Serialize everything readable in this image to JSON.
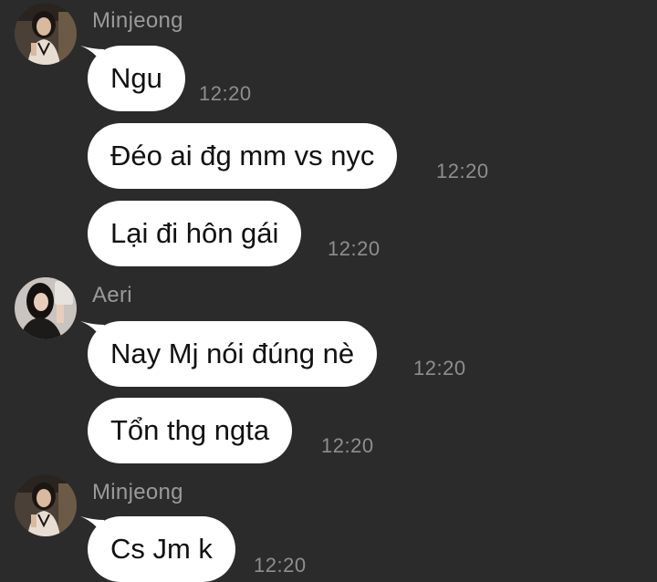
{
  "messages": [
    {
      "sender": "Minjeong",
      "text": "Ngu",
      "time": "12:20"
    },
    {
      "sender": "Minjeong",
      "text": "Đéo ai đg mm vs nyc",
      "time": "12:20"
    },
    {
      "sender": "Minjeong",
      "text": "Lại đi hôn gái",
      "time": "12:20"
    },
    {
      "sender": "Aeri",
      "text": "Nay Mj nói đúng nè",
      "time": "12:20"
    },
    {
      "sender": "Aeri",
      "text": "Tổn thg ngta",
      "time": "12:20"
    },
    {
      "sender": "Minjeong",
      "text": "Cs Jm k",
      "time": "12:20"
    }
  ],
  "groups": [
    {
      "sender": "Minjeong",
      "avatar_icon": "profile-photo-minjeong"
    },
    {
      "sender": "Aeri",
      "avatar_icon": "profile-photo-aeri"
    },
    {
      "sender": "Minjeong",
      "avatar_icon": "profile-photo-minjeong"
    }
  ],
  "colors": {
    "background": "#2b2b2b",
    "bubble": "#ffffff",
    "sender_name": "#9a9a9a",
    "timestamp": "#8e8e8e"
  }
}
